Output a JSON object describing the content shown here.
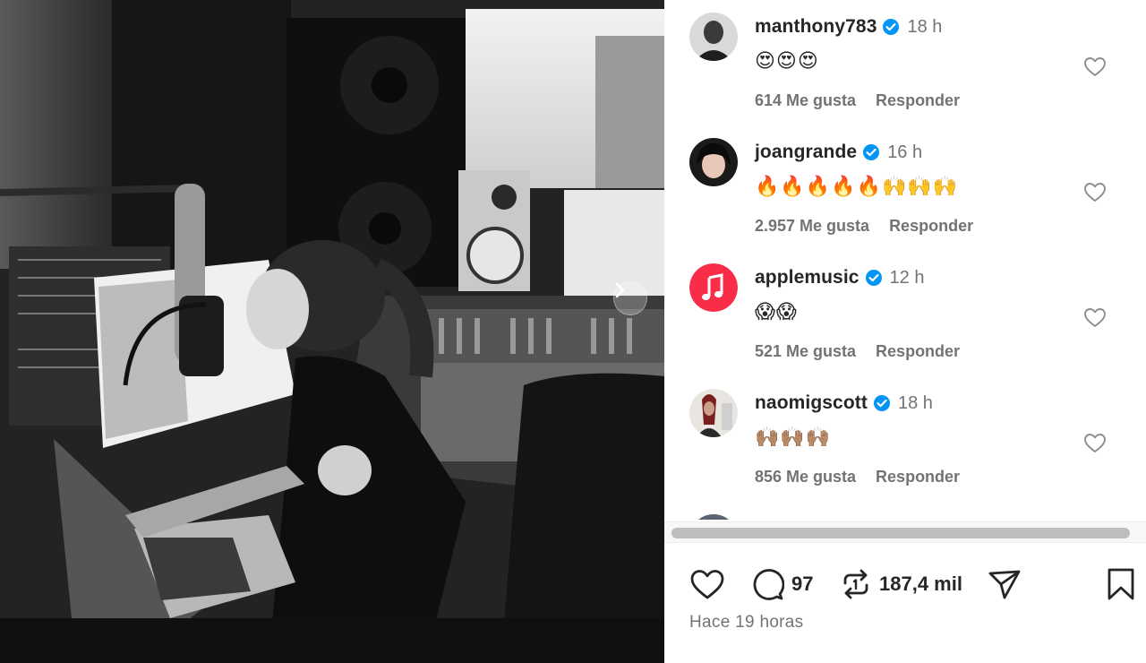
{
  "post": {
    "photo_alt": "",
    "next_icon": "chevron-right-icon"
  },
  "comments": [
    {
      "username": "manthony783",
      "verified": true,
      "time": "18 h",
      "text": "😍😍😍",
      "likes": "614 Me gusta",
      "reply": "Responder"
    },
    {
      "username": "joangrande",
      "verified": true,
      "time": "16 h",
      "text": "🔥🔥🔥🔥🔥🙌🙌🙌",
      "likes": "2.957 Me gusta",
      "reply": "Responder"
    },
    {
      "username": "applemusic",
      "verified": true,
      "time": "12 h",
      "text": "😱😱",
      "likes": "521 Me gusta",
      "reply": "Responder"
    },
    {
      "username": "naomigscott",
      "verified": true,
      "time": "18 h",
      "text": "🙌🏽🙌🏽🙌🏽",
      "likes": "856 Me gusta",
      "reply": "Responder"
    }
  ],
  "actions": {
    "like_icon": "heart-icon",
    "comment_icon": "comment-icon",
    "comment_count": "97",
    "repost_icon": "repost-icon",
    "repost_count": "187,4 mil",
    "share_icon": "send-icon",
    "save_icon": "bookmark-icon"
  },
  "posted_time": "Hace 19 horas",
  "colors": {
    "verified": "#0095f6",
    "applemusic": "#fa2d48",
    "muted_text": "#737373",
    "primary_text": "#262626"
  }
}
